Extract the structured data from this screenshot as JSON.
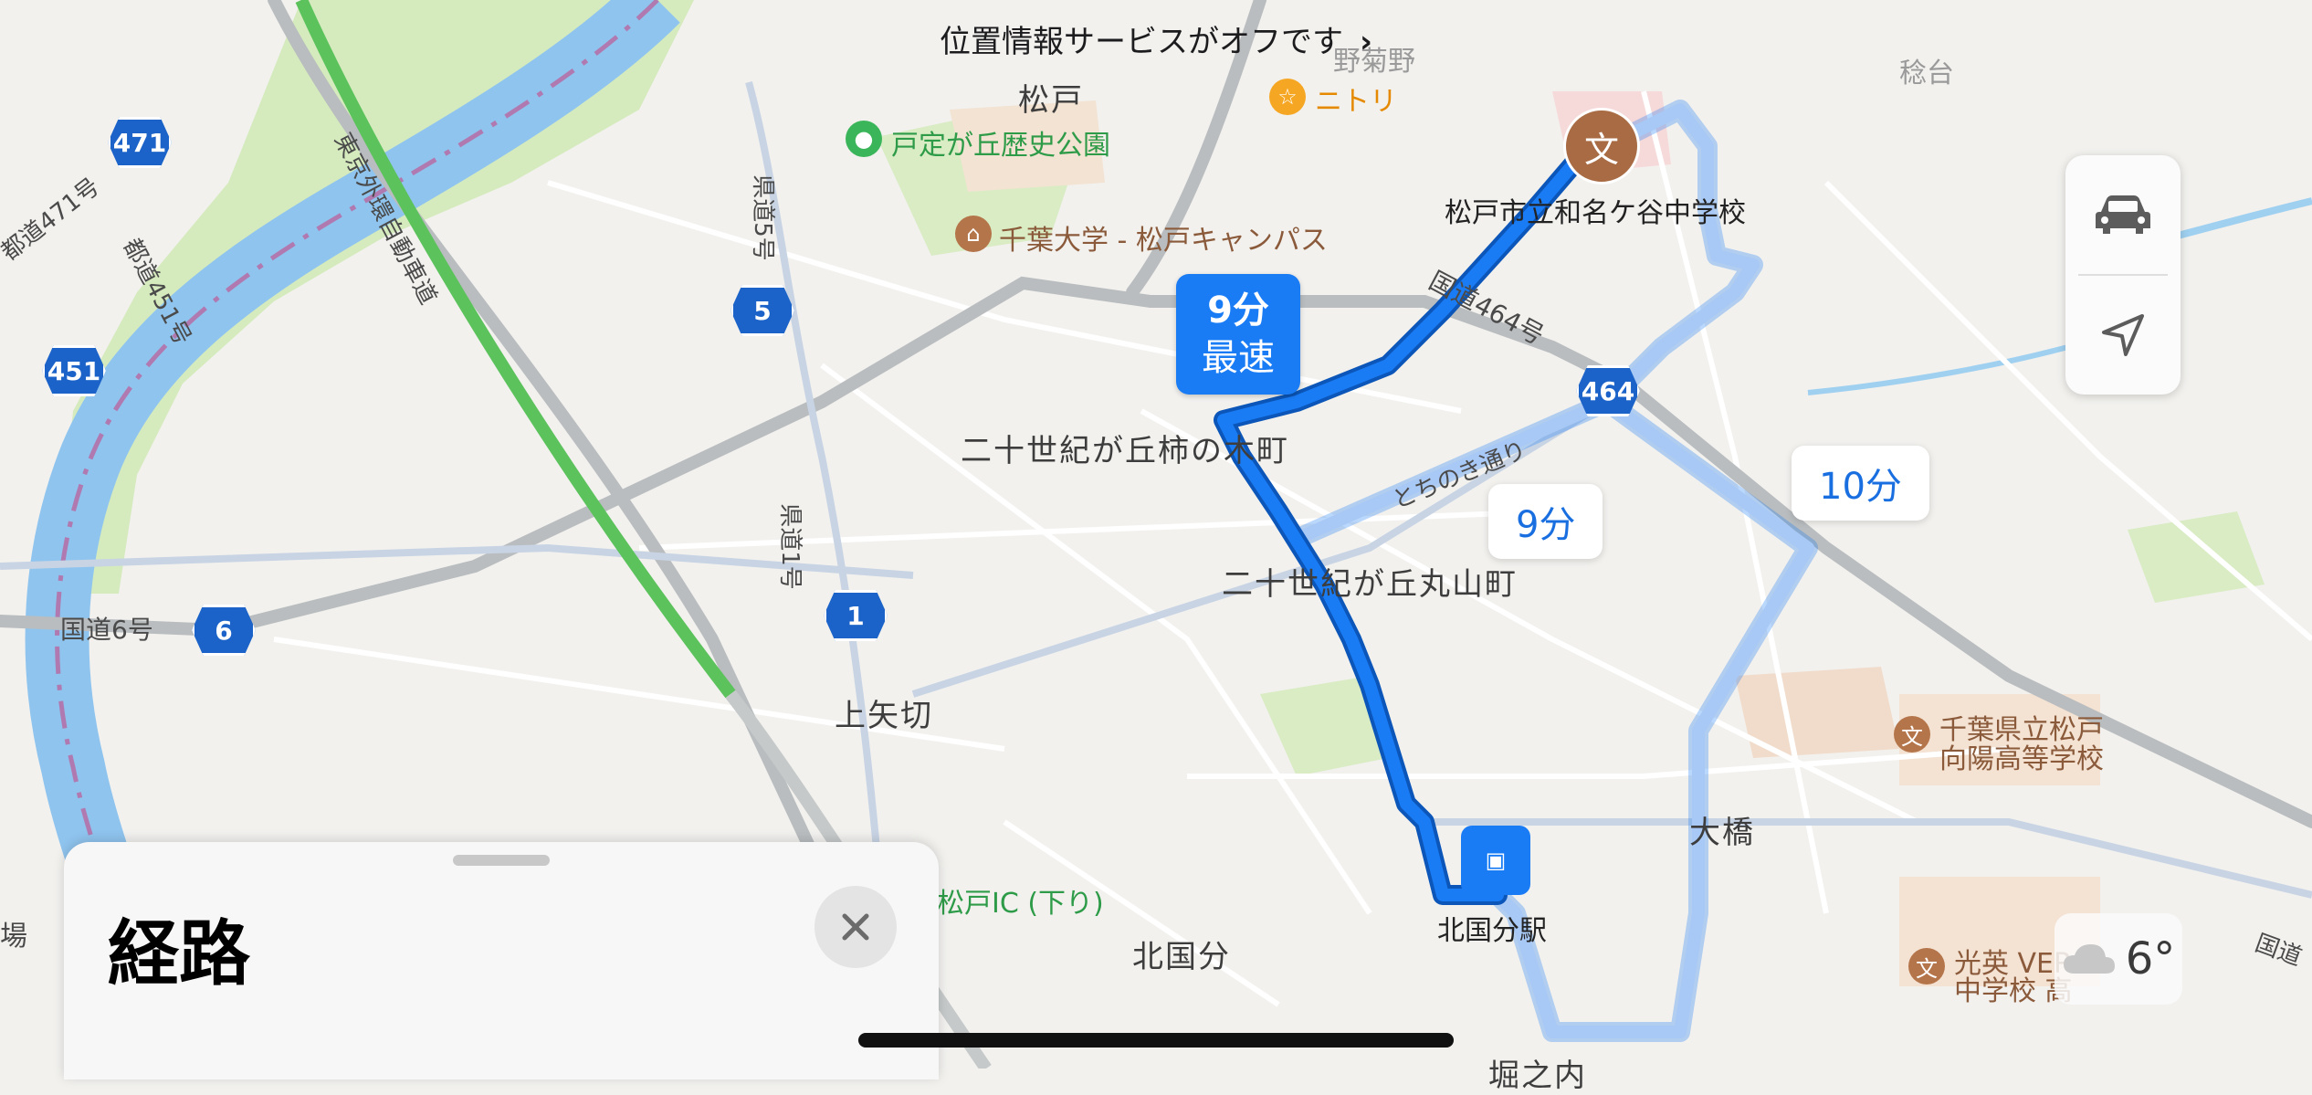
{
  "status": {
    "location_off": "位置情報サービスがオフです"
  },
  "labels": {
    "matsudo": "松戸",
    "nitori": "ニトリ",
    "park": "戸定が丘歴史公園",
    "chiba_univ": "千葉大学 - 松戸キャンパス",
    "jhs": "松戸市立和名ケ谷中学校",
    "kakinokicho": "二十世紀が丘柿の木町",
    "maruyamacho": "二十世紀が丘丸山町",
    "kamiyagiri": "上矢切",
    "kitakokubun": "北国分",
    "kitakokubun_station": "北国分駅",
    "ohashi": "大橋",
    "matsudo_ic": "松戸IC (下り)",
    "koyo_hs_1": "千葉県立松戸",
    "koyo_hs_2": "向陽高等学校",
    "koei_1": "光英 VER",
    "koei_2": "中学校 高",
    "horinouchi": "堀之内",
    "jo": "場",
    "route_464": "国道464号",
    "route_6": "国道6号",
    "route_471": "都道471号",
    "route_451": "都道451号",
    "kendo_5": "県道5号",
    "kendo_1": "県道1号",
    "gaikan": "東京外環自動車道",
    "tochinoki": "とちのき通り",
    "kanjiro_top": "野菊野",
    "tsuruya_top": "稔台",
    "right_edge": "国道"
  },
  "shields": {
    "s471": "471",
    "s451": "451",
    "s5": "5",
    "s6": "6",
    "s1": "1",
    "s464": "464"
  },
  "route": {
    "time": "9分",
    "tag": "最速"
  },
  "alternates": {
    "alt1": "9分",
    "alt2": "10分"
  },
  "weather": {
    "temp": "6°",
    "icon": "cloud-icon"
  },
  "sheet": {
    "title": "経路",
    "close_icon": "close-icon"
  },
  "controls": {
    "car_icon": "car-icon",
    "location_icon": "location-arrow-icon"
  },
  "colors": {
    "route_primary": "#1a7cf5",
    "route_alt": "#a8c8f5",
    "river": "#8fc4ee",
    "park": "#cfe7b5",
    "highway": "#5cc25c"
  }
}
